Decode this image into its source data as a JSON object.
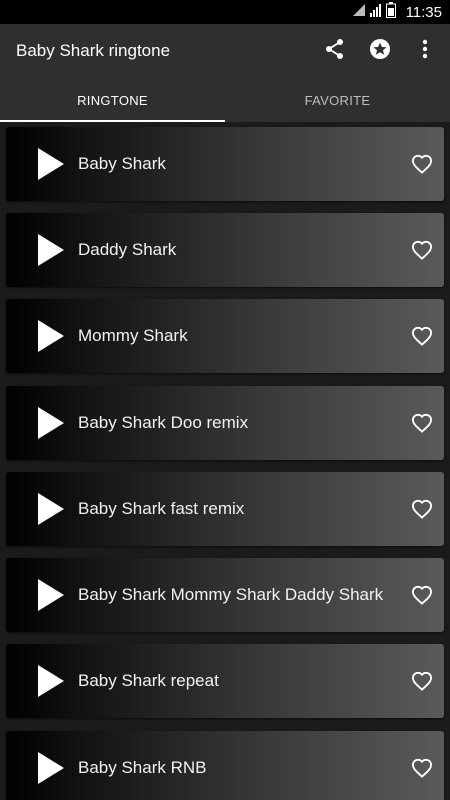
{
  "status_bar": {
    "time": "11:35",
    "icons": [
      "wifi-icon",
      "signal-icon",
      "battery-icon"
    ]
  },
  "app_bar": {
    "title": "Baby Shark ringtone",
    "actions": [
      "share-icon",
      "star-icon",
      "more-vert-icon"
    ]
  },
  "tabs": [
    {
      "label": "RINGTONE",
      "active": true
    },
    {
      "label": "FAVORITE",
      "active": false
    }
  ],
  "ringtones": [
    {
      "name": "Baby Shark"
    },
    {
      "name": "Daddy Shark"
    },
    {
      "name": "Mommy Shark"
    },
    {
      "name": "Baby Shark Doo remix"
    },
    {
      "name": "Baby Shark fast remix"
    },
    {
      "name": "Baby Shark Mommy Shark Daddy Shark"
    },
    {
      "name": "Baby Shark repeat"
    },
    {
      "name": "Baby Shark RNB"
    }
  ],
  "colors": {
    "app_bar": "#2f2f2f",
    "background": "#1b1b1b",
    "text": "#ffffff"
  }
}
